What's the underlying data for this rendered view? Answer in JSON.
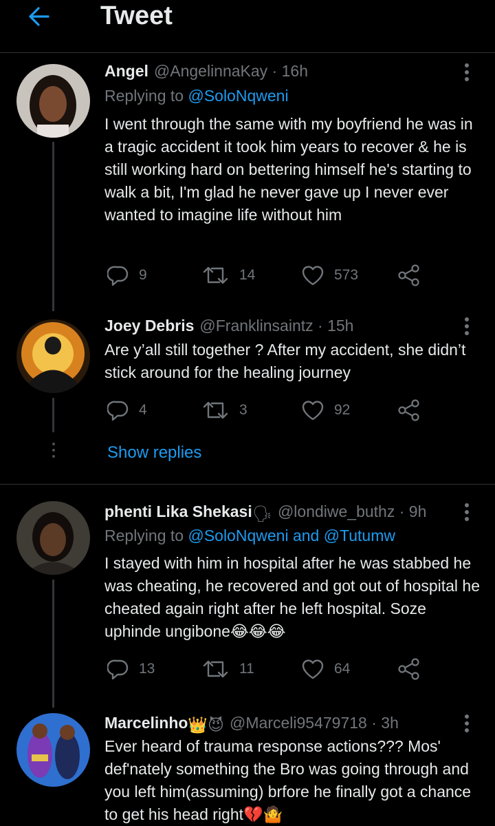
{
  "header": {
    "title": "Tweet"
  },
  "tweets": [
    {
      "name": "Angel",
      "handle": "@AngelinnaKay",
      "time": "· 16h",
      "replying_prefix": "Replying to",
      "replying_to": "@SoloNqweni",
      "text": "I went through the same with my boyfriend he was in a tragic accident it took him years to recover & he is still working hard on bettering himself he's starting to walk a bit, I'm glad he never gave up I never ever wanted to imagine life without him",
      "replies": "9",
      "retweets": "14",
      "likes": "573"
    },
    {
      "name": "Joey Debris",
      "handle": "@Franklinsaintz",
      "time": "· 15h",
      "text": "Are y’all still together ? After my accident, she didn’t stick around for the healing journey",
      "replies": "4",
      "retweets": "3",
      "likes": "92"
    },
    {
      "name": "phenti Lika Shekasi",
      "name_emoji": "🗣",
      "handle": "@londiwe_buthz",
      "time": "· 9h",
      "replying_prefix": "Replying to",
      "replying_to": "@SoloNqweni and @Tutumw",
      "text": "I stayed with him in hospital after he was stabbed he was cheating, he recovered and got out of hospital he cheated again right after he left hospital. Soze uphinde ungibone😂😂😂",
      "replies": "13",
      "retweets": "11",
      "likes": "64"
    },
    {
      "name": "Marcelinho",
      "name_emoji": "👑😈",
      "handle": "@Marceli95479718",
      "time": "· 3h",
      "text": "Ever heard of trauma response actions??? Mos' def'nately something the Bro was going through and you left him(assuming) brfore he finally got a chance to get his head right💔🤷"
    }
  ],
  "show_replies": "Show replies",
  "colors": {
    "accent": "#1d9bf0",
    "background": "#000000",
    "muted": "#71767b"
  }
}
